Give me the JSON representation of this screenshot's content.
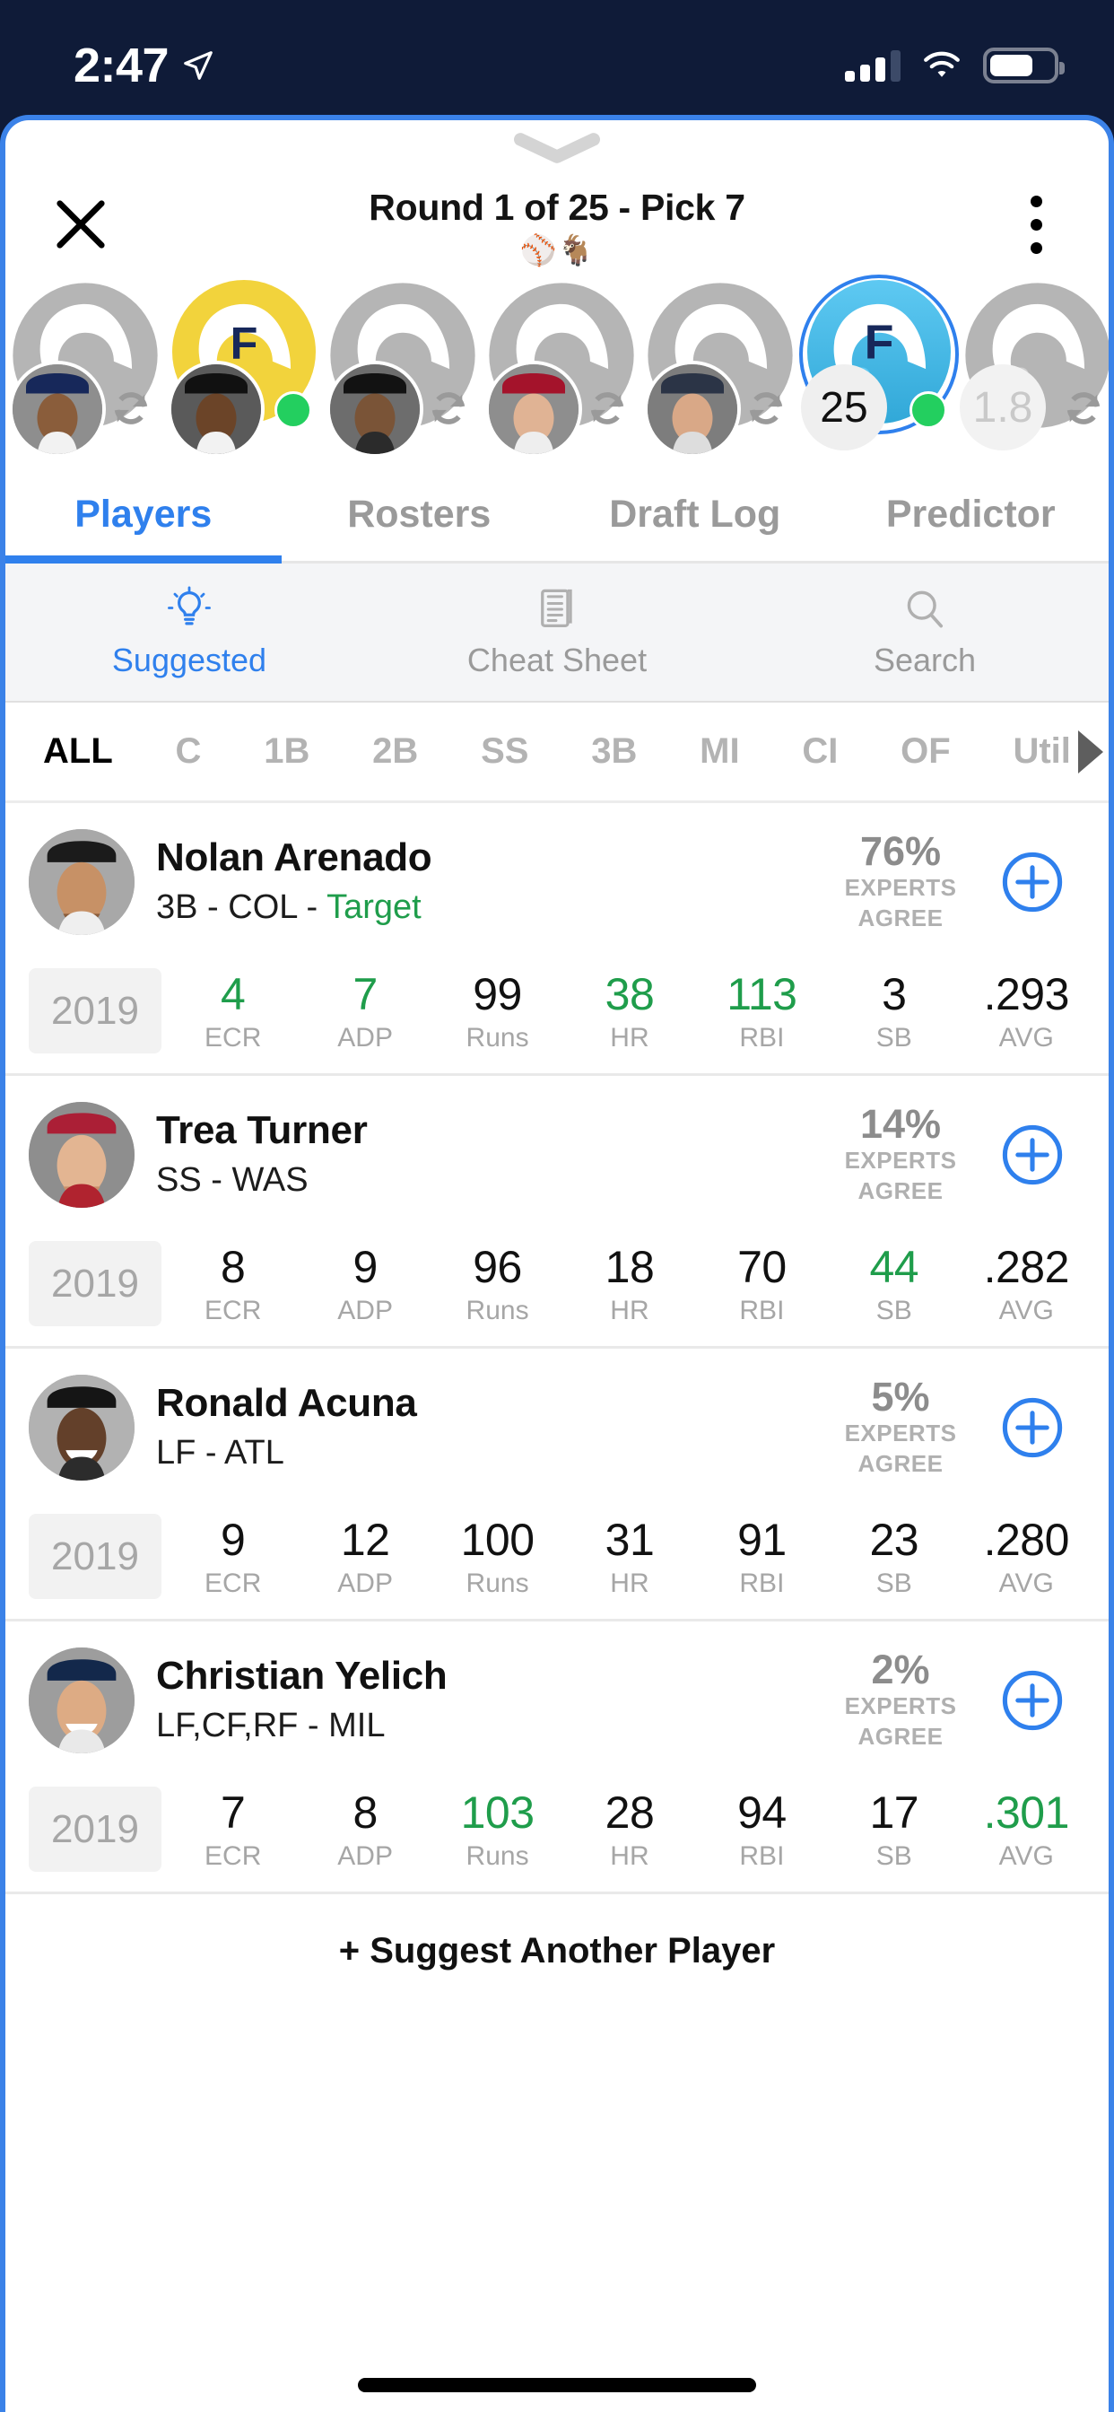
{
  "status_bar": {
    "time": "2:47",
    "location_icon": "location-arrow-icon",
    "signal_icon": "cellular-signal-icon",
    "wifi_icon": "wifi-icon",
    "battery_icon": "battery-icon"
  },
  "header": {
    "close_icon": "close-icon",
    "menu_icon": "overflow-menu-icon",
    "grabber_icon": "chevron-down-grabber-icon",
    "title": "Round 1 of 25 - Pick 7",
    "emoji": "⚾🐐"
  },
  "draft_order": {
    "picks": [
      {
        "slot": 1,
        "type": "player",
        "team_cap": "BOS",
        "status": "drafted",
        "badge": "",
        "auto_icon": "refresh-icon",
        "highlight": "none"
      },
      {
        "slot": 2,
        "type": "player",
        "team_cap": "CLE",
        "status": "drafted",
        "badge": "",
        "auto_icon": "",
        "highlight": "yellow"
      },
      {
        "slot": 3,
        "type": "player",
        "team_cap": "CLE",
        "status": "drafted",
        "badge": "",
        "auto_icon": "refresh-icon",
        "highlight": "none"
      },
      {
        "slot": 4,
        "type": "player",
        "team_cap": "WAS",
        "status": "drafted",
        "badge": "",
        "auto_icon": "refresh-icon",
        "highlight": "none"
      },
      {
        "slot": 5,
        "type": "player",
        "team_cap": "BOS",
        "status": "drafted",
        "badge": "",
        "auto_icon": "refresh-icon",
        "highlight": "none"
      },
      {
        "slot": 6,
        "type": "onclock",
        "team_cap": "",
        "status": "on-the-clock",
        "badge": "25",
        "auto_icon": "",
        "highlight": "cyan"
      },
      {
        "slot": 7,
        "type": "upcoming",
        "team_cap": "",
        "status": "upcoming",
        "badge": "1.8",
        "auto_icon": "refresh-icon",
        "highlight": "none"
      }
    ]
  },
  "tabs": [
    {
      "label": "Players",
      "active": true
    },
    {
      "label": "Rosters",
      "active": false
    },
    {
      "label": "Draft Log",
      "active": false
    },
    {
      "label": "Predictor",
      "active": false
    }
  ],
  "subtabs": [
    {
      "label": "Suggested",
      "icon": "lightbulb-icon",
      "active": true
    },
    {
      "label": "Cheat Sheet",
      "icon": "document-icon",
      "active": false
    },
    {
      "label": "Search",
      "icon": "search-icon",
      "active": false
    }
  ],
  "positions": {
    "items": [
      "ALL",
      "C",
      "1B",
      "2B",
      "SS",
      "3B",
      "MI",
      "CI",
      "OF",
      "Util"
    ],
    "active": "ALL",
    "scroll_arrow_icon": "chevron-right-icon"
  },
  "stat_labels": [
    "ECR",
    "ADP",
    "Runs",
    "HR",
    "RBI",
    "SB",
    "AVG"
  ],
  "players": [
    {
      "name": "Nolan Arenado",
      "meta_prefix": "3B - COL - ",
      "tag": "Target",
      "percent": "76%",
      "experts_line1": "EXPERTS",
      "experts_line2": "AGREE",
      "add_icon": "plus-circle-icon",
      "season": "2019",
      "stats": [
        {
          "label": "ECR",
          "value": "4",
          "green": true
        },
        {
          "label": "ADP",
          "value": "7",
          "green": true
        },
        {
          "label": "Runs",
          "value": "99",
          "green": false
        },
        {
          "label": "HR",
          "value": "38",
          "green": true
        },
        {
          "label": "RBI",
          "value": "113",
          "green": true
        },
        {
          "label": "SB",
          "value": "3",
          "green": false
        },
        {
          "label": "AVG",
          "value": ".293",
          "green": false
        }
      ]
    },
    {
      "name": "Trea Turner",
      "meta_prefix": "SS - WAS",
      "tag": "",
      "percent": "14%",
      "experts_line1": "EXPERTS",
      "experts_line2": "AGREE",
      "add_icon": "plus-circle-icon",
      "season": "2019",
      "stats": [
        {
          "label": "ECR",
          "value": "8",
          "green": false
        },
        {
          "label": "ADP",
          "value": "9",
          "green": false
        },
        {
          "label": "Runs",
          "value": "96",
          "green": false
        },
        {
          "label": "HR",
          "value": "18",
          "green": false
        },
        {
          "label": "RBI",
          "value": "70",
          "green": false
        },
        {
          "label": "SB",
          "value": "44",
          "green": true
        },
        {
          "label": "AVG",
          "value": ".282",
          "green": false
        }
      ]
    },
    {
      "name": "Ronald Acuna",
      "meta_prefix": "LF - ATL",
      "tag": "",
      "percent": "5%",
      "experts_line1": "EXPERTS",
      "experts_line2": "AGREE",
      "add_icon": "plus-circle-icon",
      "season": "2019",
      "stats": [
        {
          "label": "ECR",
          "value": "9",
          "green": false
        },
        {
          "label": "ADP",
          "value": "12",
          "green": false
        },
        {
          "label": "Runs",
          "value": "100",
          "green": false
        },
        {
          "label": "HR",
          "value": "31",
          "green": false
        },
        {
          "label": "RBI",
          "value": "91",
          "green": false
        },
        {
          "label": "SB",
          "value": "23",
          "green": false
        },
        {
          "label": "AVG",
          "value": ".280",
          "green": false
        }
      ]
    },
    {
      "name": "Christian Yelich",
      "meta_prefix": "LF,CF,RF - MIL",
      "tag": "",
      "percent": "2%",
      "experts_line1": "EXPERTS",
      "experts_line2": "AGREE",
      "add_icon": "plus-circle-icon",
      "season": "2019",
      "stats": [
        {
          "label": "ECR",
          "value": "7",
          "green": false
        },
        {
          "label": "ADP",
          "value": "8",
          "green": false
        },
        {
          "label": "Runs",
          "value": "103",
          "green": true
        },
        {
          "label": "HR",
          "value": "28",
          "green": false
        },
        {
          "label": "RBI",
          "value": "94",
          "green": false
        },
        {
          "label": "SB",
          "value": "17",
          "green": false
        },
        {
          "label": "AVG",
          "value": ".301",
          "green": true
        }
      ]
    }
  ],
  "footer": {
    "suggest_another": "+ Suggest Another Player"
  },
  "colors": {
    "accent_blue": "#2f80ed",
    "status_bar_navy": "#0f1b38",
    "positive_green": "#1f9d4b",
    "on_clock_cyan": "#4fc3ef",
    "highlight_yellow": "#f2d33c",
    "online_green": "#23cf5f"
  }
}
